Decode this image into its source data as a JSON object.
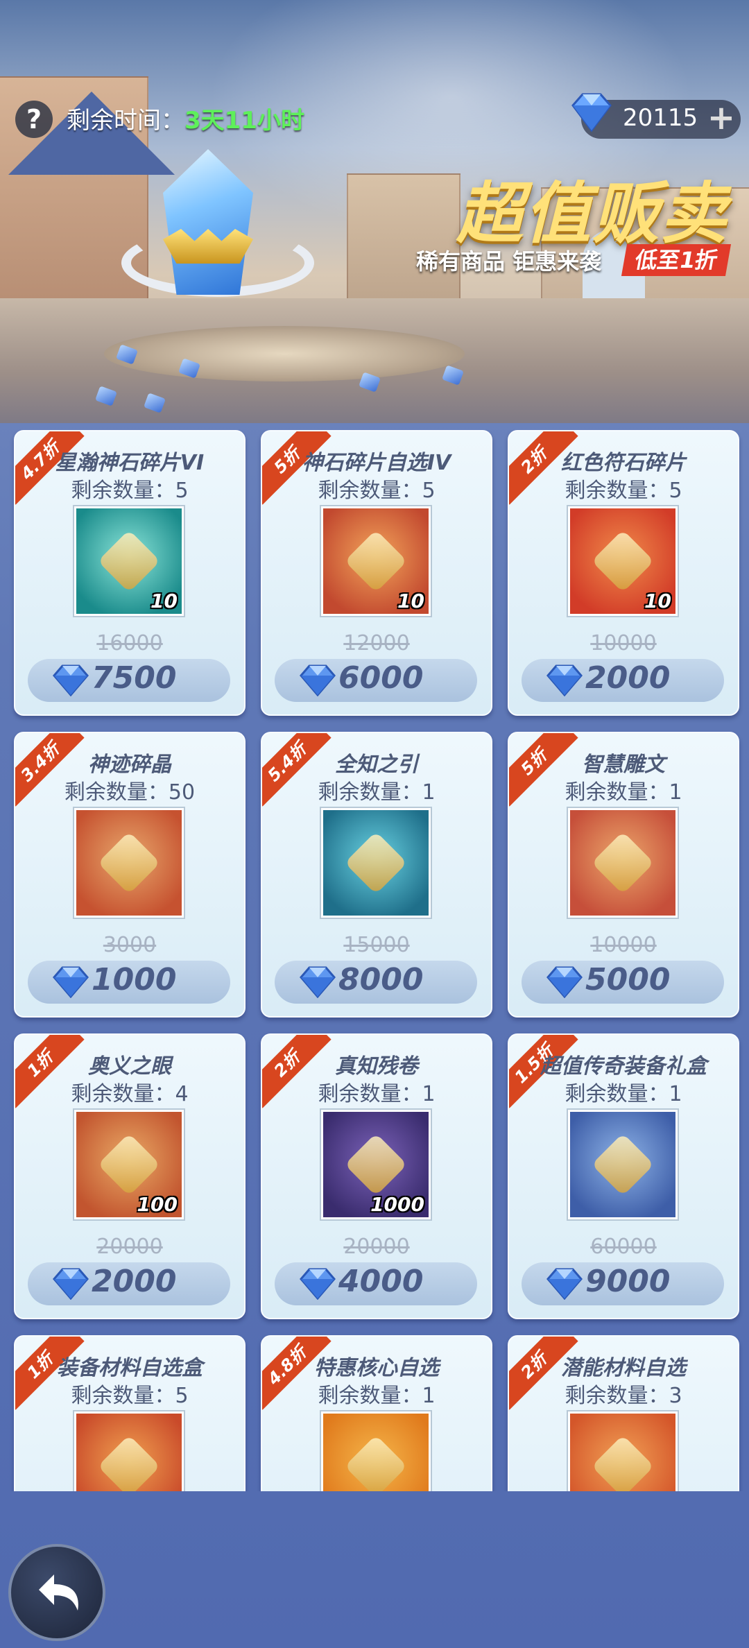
{
  "hud": {
    "help_label": "?",
    "timer_label": "剩余时间：",
    "timer_value": "3天11小时",
    "currency_value": "20115",
    "plus_label": "+"
  },
  "banner": {
    "title": "超值贩卖",
    "subtitle": "稀有商品 钜惠来袭",
    "discount_tag": "低至1折"
  },
  "items": [
    {
      "discount": "4.7折",
      "name": "星瀚神石碎片VI",
      "remaining": "剩余数量：5",
      "qty": "10",
      "original": "16000",
      "price": "7500",
      "icon": "chest-icon",
      "colors": [
        "#1a8b8b",
        "#8be4d8"
      ]
    },
    {
      "discount": "5折",
      "name": "神石碎片自选IV",
      "remaining": "剩余数量：5",
      "qty": "10",
      "original": "12000",
      "price": "6000",
      "icon": "chest-icon",
      "colors": [
        "#c2492f",
        "#f2a35a"
      ]
    },
    {
      "discount": "2折",
      "name": "红色符石碎片",
      "remaining": "剩余数量：5",
      "qty": "10",
      "original": "10000",
      "price": "2000",
      "icon": "rune-icon",
      "colors": [
        "#d23c28",
        "#f08a4a"
      ]
    },
    {
      "discount": "3.4折",
      "name": "神迹碎晶",
      "remaining": "剩余数量：50",
      "qty": "",
      "original": "3000",
      "price": "1000",
      "icon": "crystal-shard-icon",
      "colors": [
        "#c65230",
        "#e7a66b"
      ]
    },
    {
      "discount": "5.4折",
      "name": "全知之引",
      "remaining": "剩余数量：1",
      "qty": "",
      "original": "15000",
      "price": "8000",
      "icon": "orb-icon",
      "colors": [
        "#1f6f8a",
        "#68d0e0"
      ]
    },
    {
      "discount": "5折",
      "name": "智慧雕文",
      "remaining": "剩余数量：1",
      "qty": "",
      "original": "10000",
      "price": "5000",
      "icon": "star-glyph-icon",
      "colors": [
        "#c64f3a",
        "#eba56a"
      ]
    },
    {
      "discount": "1折",
      "name": "奥义之眼",
      "remaining": "剩余数量：4",
      "qty": "100",
      "original": "20000",
      "price": "2000",
      "icon": "eye-icon",
      "colors": [
        "#c2552f",
        "#e9a965"
      ]
    },
    {
      "discount": "2折",
      "name": "真知残卷",
      "remaining": "剩余数量：1",
      "qty": "1000",
      "original": "20000",
      "price": "4000",
      "icon": "scroll-icon",
      "colors": [
        "#3a2c6e",
        "#7b62b8"
      ]
    },
    {
      "discount": "1.5折",
      "name": "超值传奇装备礼盒",
      "remaining": "剩余数量：1",
      "qty": "",
      "original": "60000",
      "price": "9000",
      "icon": "armor-icon",
      "colors": [
        "#3e5ea8",
        "#8db2e6"
      ]
    },
    {
      "discount": "1折",
      "name": "装备材料自选盒",
      "remaining": "剩余数量：5",
      "qty": "",
      "original": "",
      "price": "",
      "icon": "armor-icon",
      "colors": [
        "#c94a2a",
        "#f0a050"
      ]
    },
    {
      "discount": "4.8折",
      "name": "特惠核心自选",
      "remaining": "剩余数量：1",
      "qty": "",
      "original": "",
      "price": "",
      "icon": "card-icon",
      "colors": [
        "#e07a1c",
        "#f5b54a"
      ]
    },
    {
      "discount": "2折",
      "name": "潜能材料自选",
      "remaining": "剩余数量：3",
      "qty": "",
      "original": "",
      "price": "",
      "icon": "chest-icon",
      "colors": [
        "#d4562a",
        "#f1a055"
      ]
    }
  ],
  "colors": {
    "discount_ribbon": "#d8461f",
    "timer_green": "#5ef05a",
    "title_gold": "#ffe179"
  }
}
